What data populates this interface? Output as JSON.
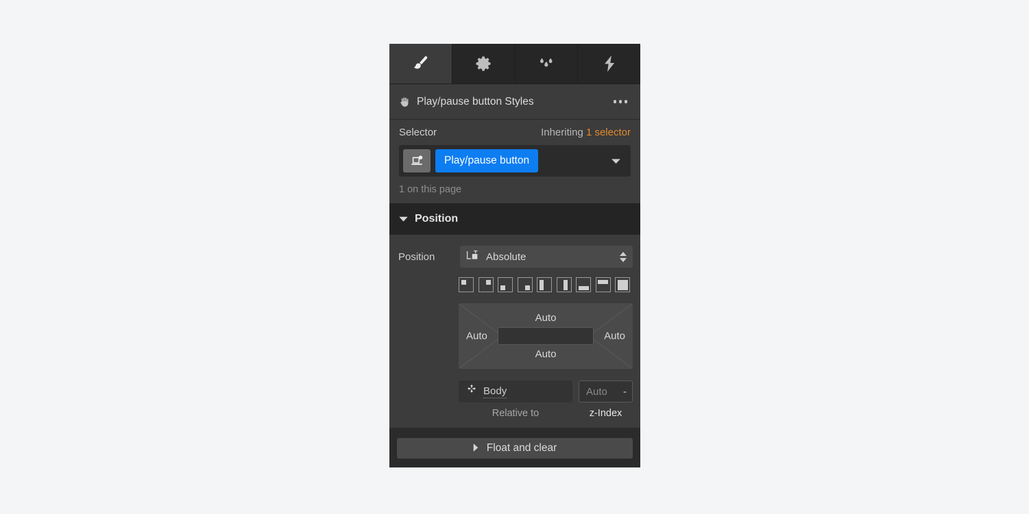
{
  "tabs": [
    {
      "name": "style-tab",
      "icon": "paintbrush-icon",
      "active": true
    },
    {
      "name": "settings-tab",
      "icon": "gear-icon",
      "active": false
    },
    {
      "name": "interactions-tab",
      "icon": "droplets-icon",
      "active": false
    },
    {
      "name": "effects-tab",
      "icon": "lightning-icon",
      "active": false
    }
  ],
  "header": {
    "hand_icon": "hand-icon",
    "title": "Play/pause button Styles",
    "more_icon": "ellipsis-icon"
  },
  "selector": {
    "label": "Selector",
    "inheriting_prefix": "Inheriting ",
    "inheriting_count": "1 selector",
    "element_icon": "device-badge-icon",
    "chip_label": "Play/pause button",
    "caret_icon": "chevron-down-icon",
    "sub_text": "1 on this page"
  },
  "section": {
    "caret_icon": "caret-down-icon",
    "title": "Position"
  },
  "position": {
    "label": "Position",
    "value": "Absolute",
    "value_icon": "position-absolute-icon",
    "stepper_icon": "stepper-updown-icon",
    "presets": [
      "align-top-left",
      "align-top-right",
      "align-bottom-left",
      "align-bottom-right",
      "align-left-full",
      "align-right-full",
      "align-bottom-stretch",
      "align-top-stretch",
      "align-fill"
    ],
    "offsets": {
      "top": "Auto",
      "right": "Auto",
      "bottom": "Auto",
      "left": "Auto",
      "center_value": ""
    },
    "relative_to": {
      "icon": "move-target-icon",
      "value": "Body",
      "caption": "Relative to"
    },
    "z_index": {
      "value": "Auto",
      "dash": "-",
      "caption": "z-Index"
    }
  },
  "float_and_clear": {
    "caret_icon": "caret-right-icon",
    "label": "Float and clear"
  },
  "colors": {
    "accent_blue": "#0d7df2",
    "inherit_orange": "#e08a2e",
    "panel_bg": "#2b2b2b",
    "body_bg": "#3c3c3c",
    "section_head_bg": "#242424",
    "page_bg": "#f4f5f7"
  }
}
